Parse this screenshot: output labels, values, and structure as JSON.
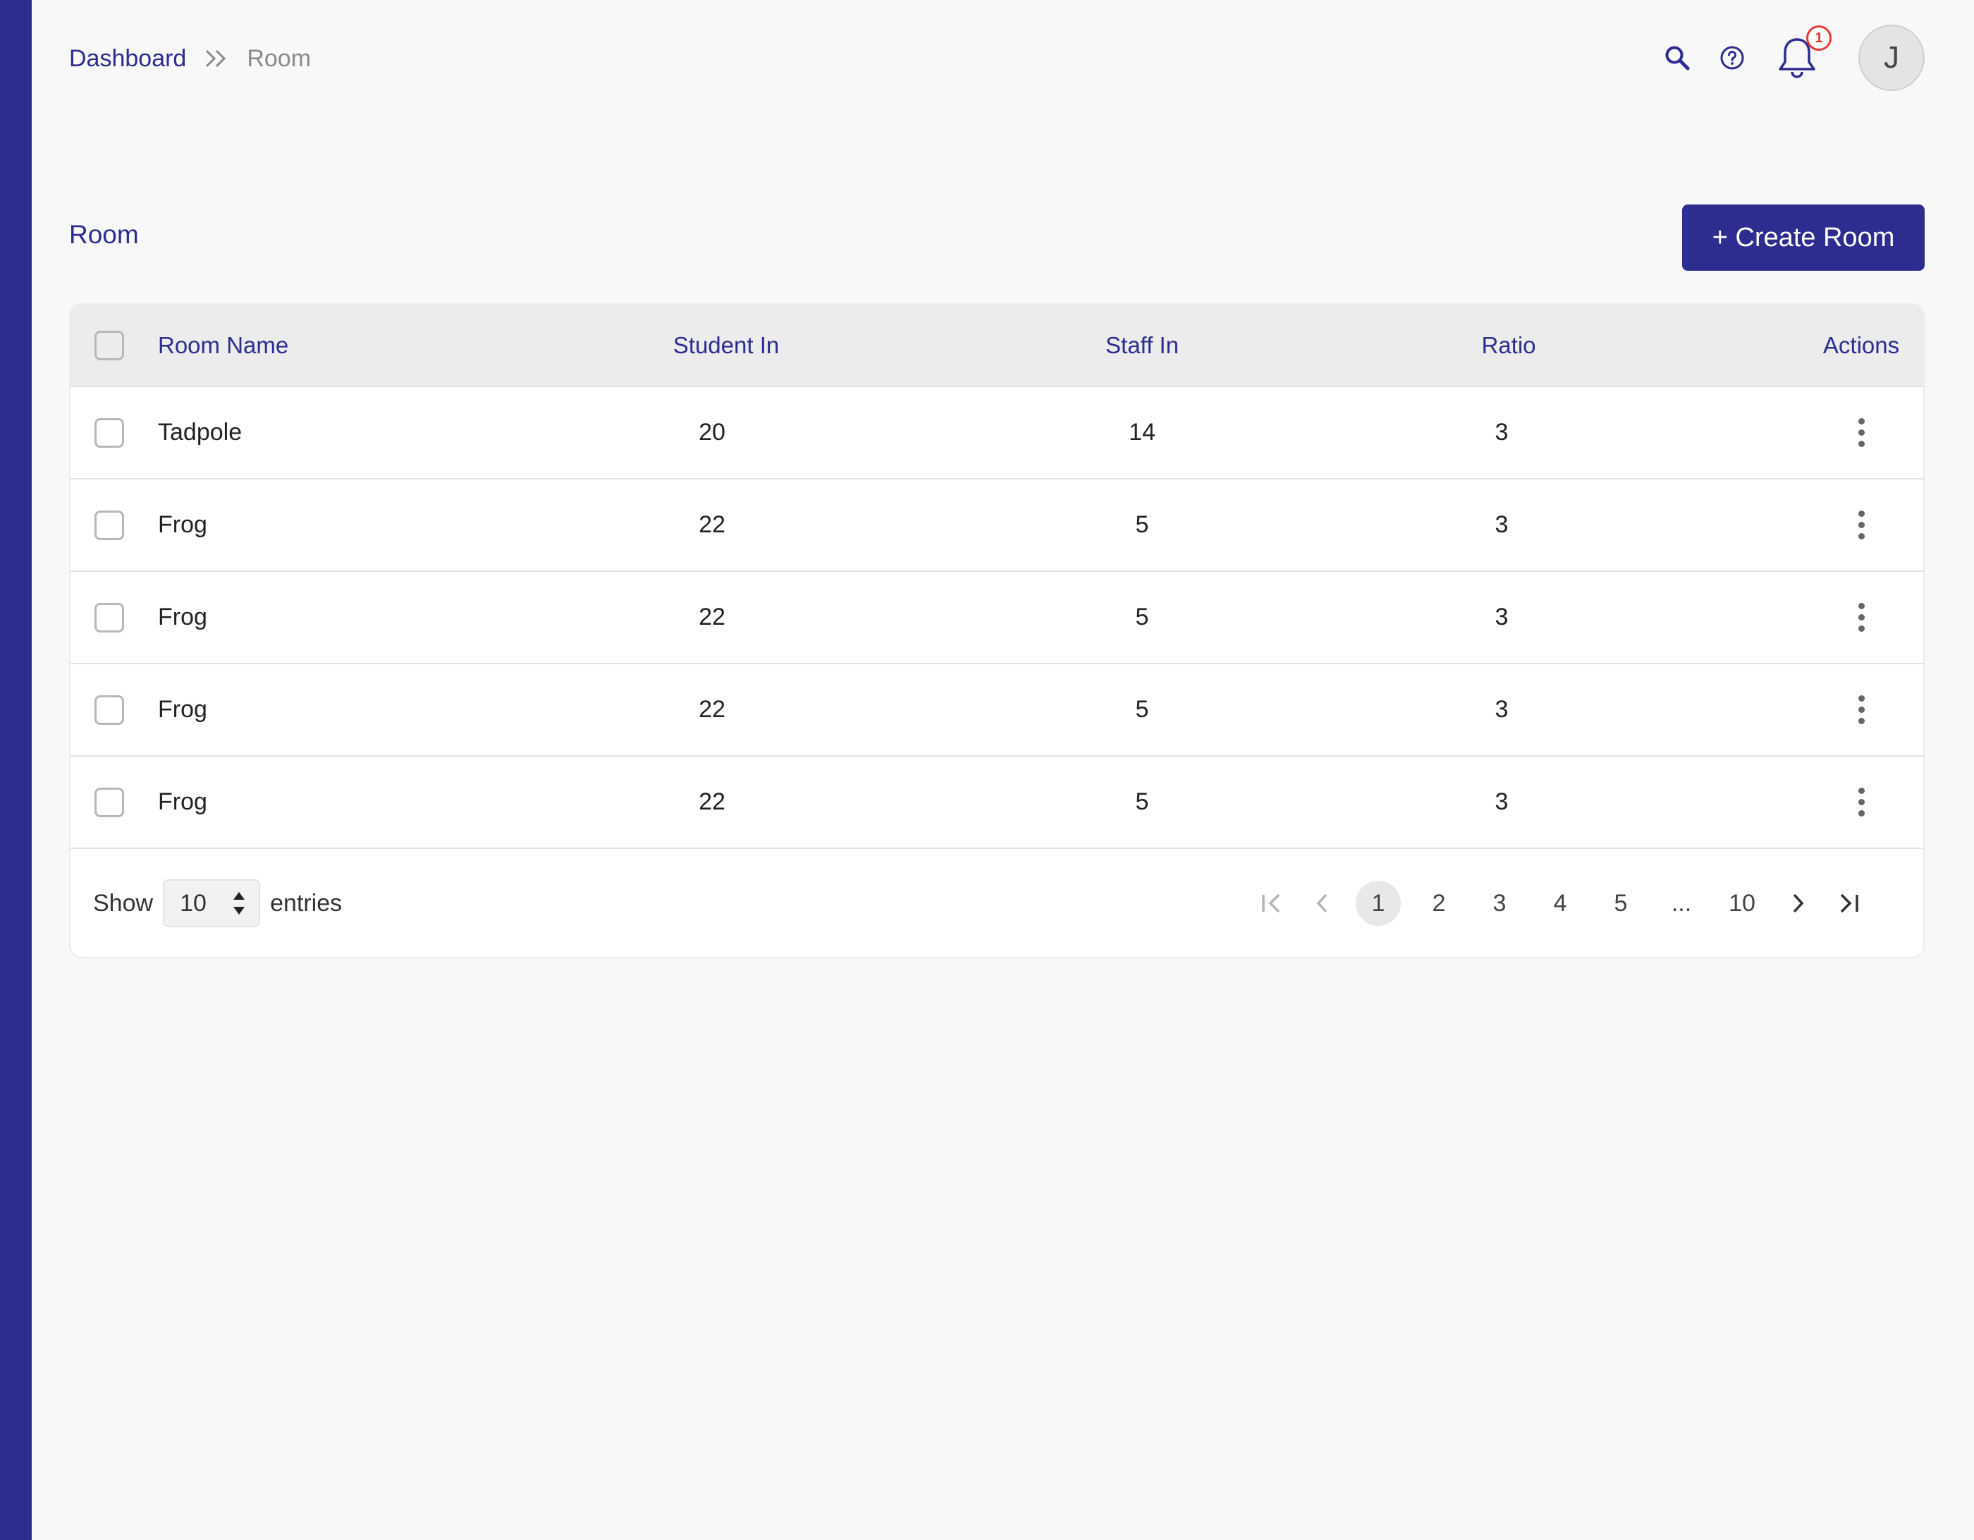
{
  "breadcrumb": {
    "home": "Dashboard",
    "current": "Room"
  },
  "header": {
    "notification_count": "1",
    "avatar_initial": "J"
  },
  "page": {
    "title": "Room",
    "create_button": "+ Create Room"
  },
  "table": {
    "columns": {
      "name": "Room Name",
      "student": "Student In",
      "staff": "Staff In",
      "ratio": "Ratio",
      "actions": "Actions"
    },
    "rows": [
      {
        "name": "Tadpole",
        "student": "20",
        "staff": "14",
        "ratio": "3"
      },
      {
        "name": "Frog",
        "student": "22",
        "staff": "5",
        "ratio": "3"
      },
      {
        "name": "Frog",
        "student": "22",
        "staff": "5",
        "ratio": "3"
      },
      {
        "name": "Frog",
        "student": "22",
        "staff": "5",
        "ratio": "3"
      },
      {
        "name": "Frog",
        "student": "22",
        "staff": "5",
        "ratio": "3"
      }
    ]
  },
  "footer": {
    "show_label": "Show",
    "entries_value": "10",
    "entries_label": "entries"
  },
  "pagination": {
    "pages": [
      "1",
      "2",
      "3",
      "4",
      "5"
    ],
    "ellipsis": "...",
    "last_page": "10",
    "active_page": "1"
  },
  "colors": {
    "primary": "#2d2d8f",
    "badge": "#e53935"
  }
}
